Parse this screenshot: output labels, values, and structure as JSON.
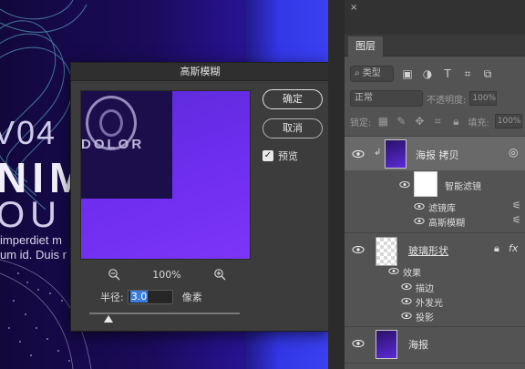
{
  "poster": {
    "number": "V04",
    "big_word_1": "NIM",
    "big_word_2": "OU",
    "line_1": "imperdiet m",
    "line_2": "um id. Duis r"
  },
  "dialog": {
    "title": "高斯模糊",
    "ok_label": "确定",
    "cancel_label": "取消",
    "preview_label": "预览",
    "preview_checked": true,
    "preview_word": "DOLOR",
    "zoom_value": "100%",
    "radius_label": "半径:",
    "radius_value": "3.0",
    "radius_unit": "像素",
    "slider_level_fraction": 0.13
  },
  "panel": {
    "close_glyph": "×",
    "tab_label": "图层",
    "filter_type": "类型",
    "blend_mode": "正常",
    "opacity_label": "不透明度:",
    "opacity_value": "100%",
    "lock_label": "锁定:",
    "fill_label": "填充:",
    "fill_value": "100%",
    "layers": {
      "copy_name": "海报 拷贝",
      "smart_filter": "智能滤镜",
      "filter_gallery": "滤镜库",
      "gaussian_blur": "高斯模糊",
      "glass_name": "玻璃形状",
      "effects": "效果",
      "stroke": "描边",
      "outer_glow": "外发光",
      "drop_shadow": "投影",
      "poster_name": "海报"
    }
  },
  "colors": {
    "canvas_dark": "#12083c",
    "canvas_blue": "#3b40f2",
    "preview_purple": "#6f2ef0",
    "selection_blue": "#3a7be0"
  }
}
